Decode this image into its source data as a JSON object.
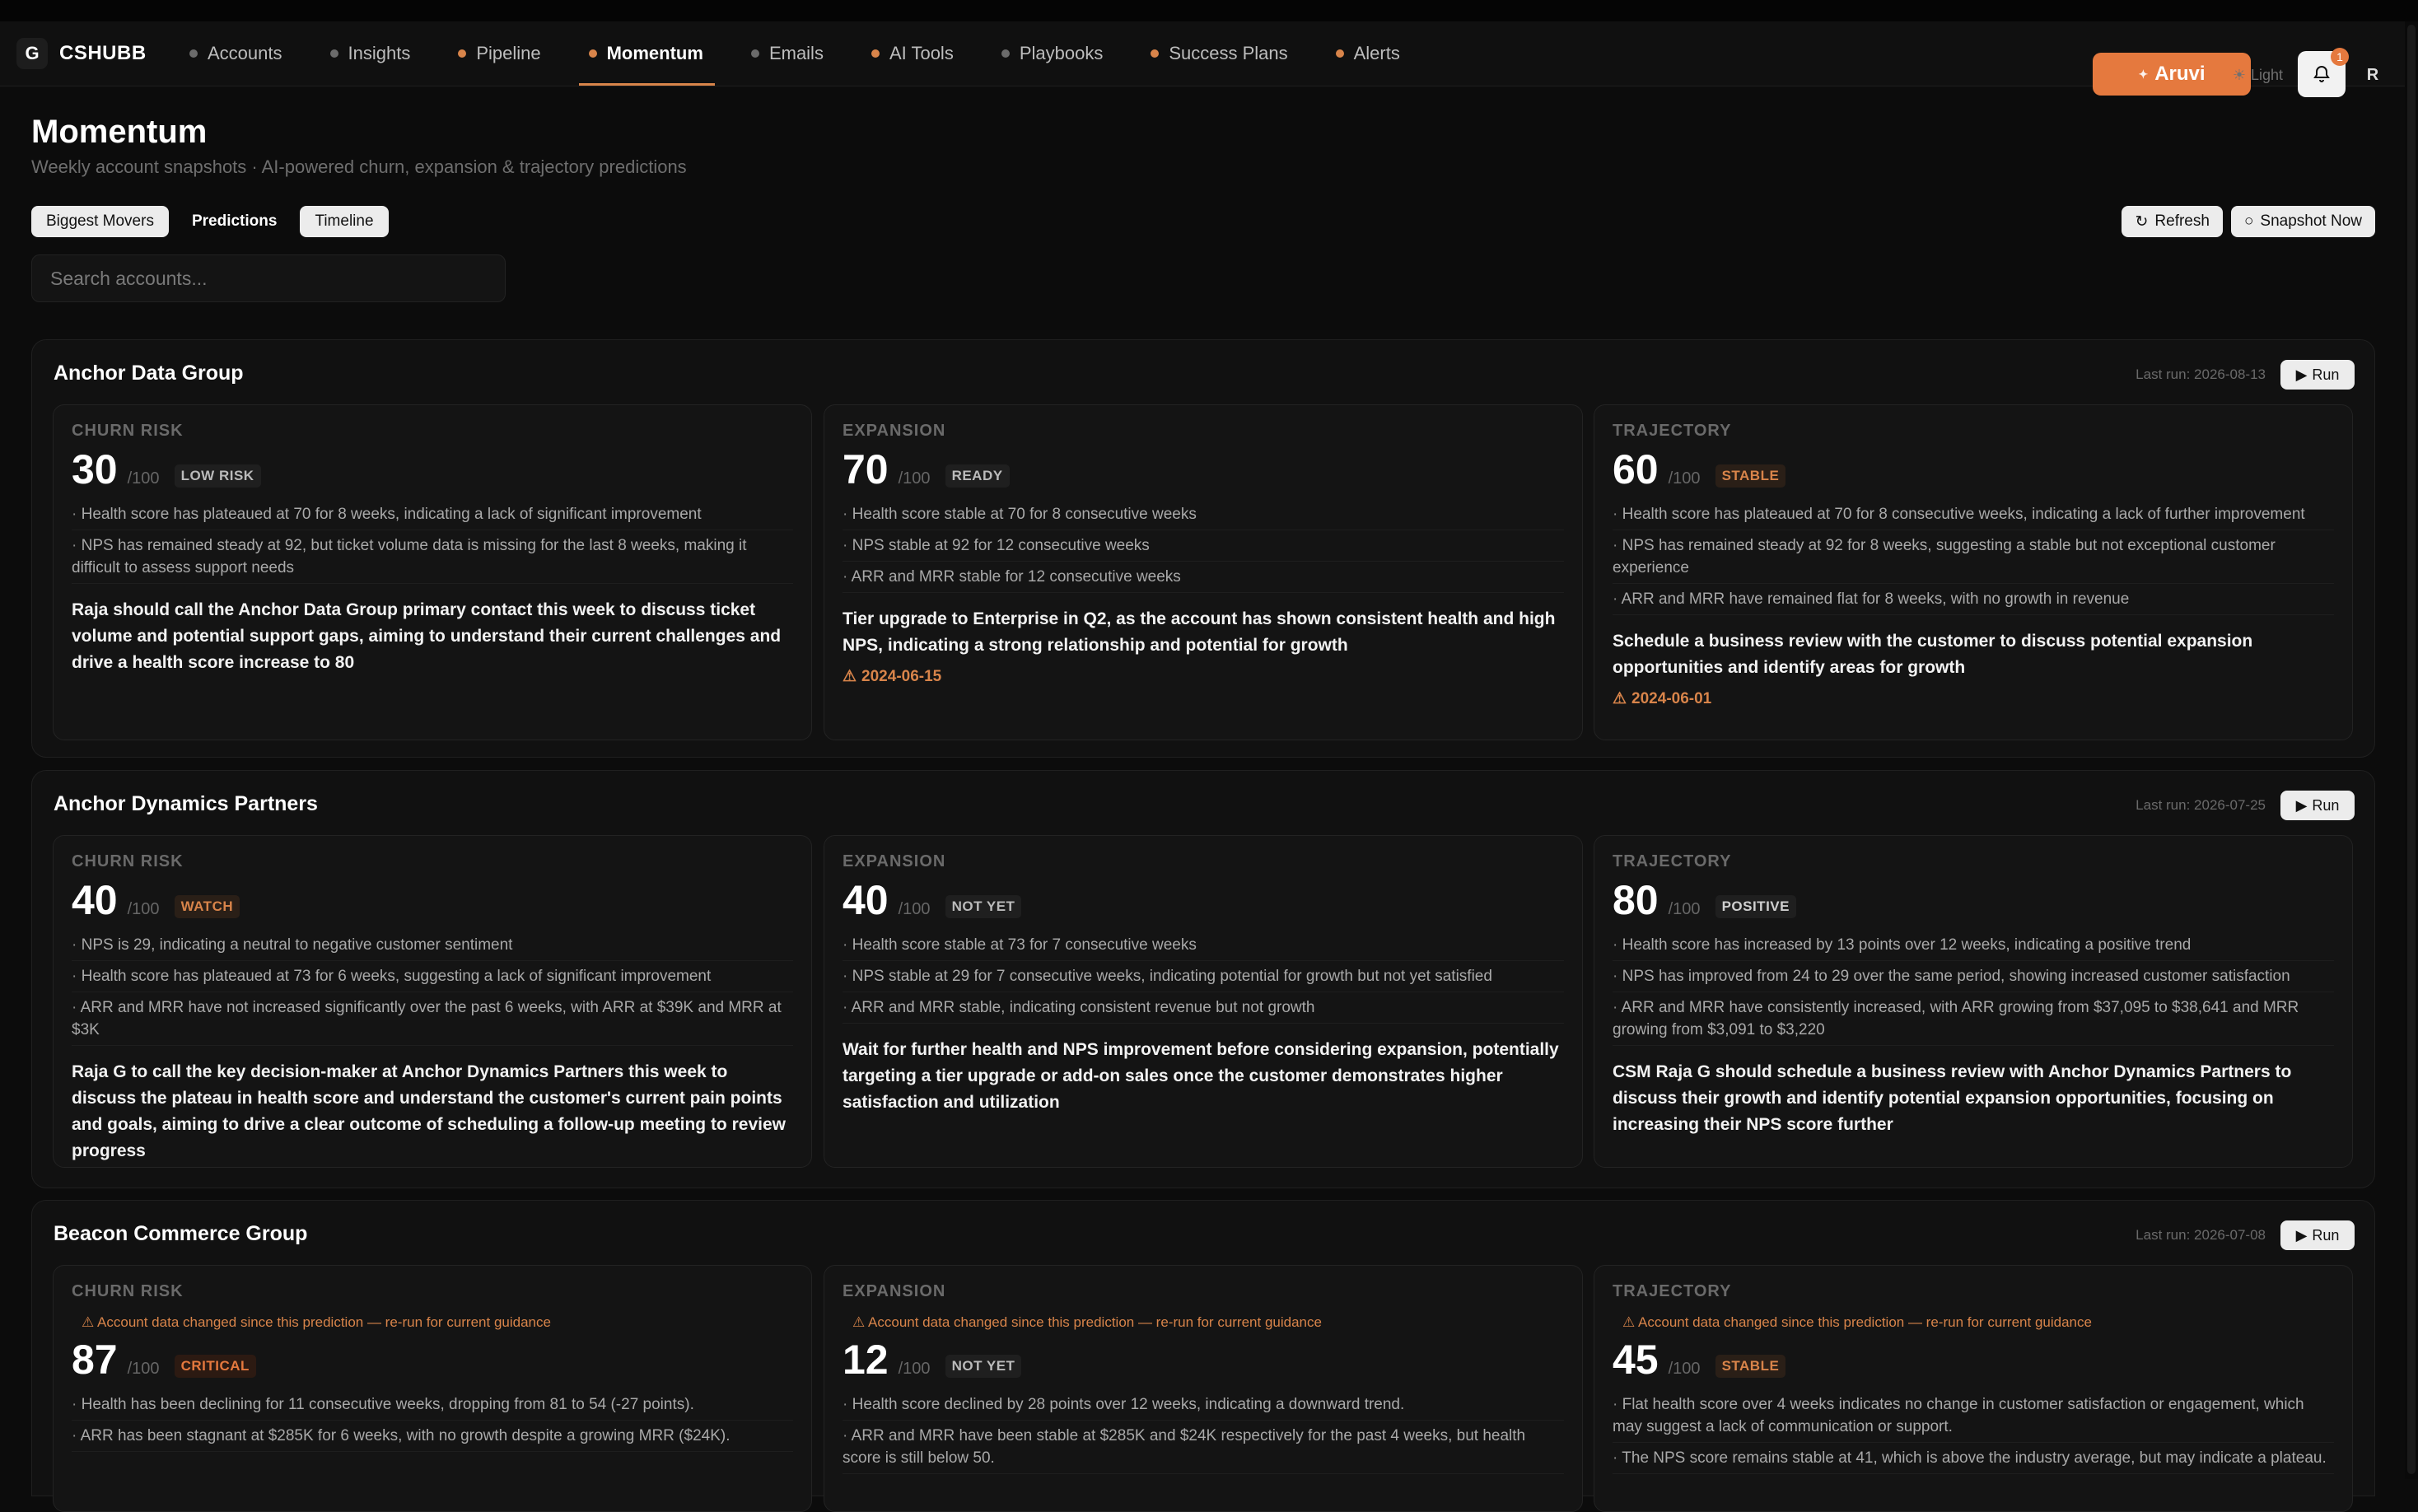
{
  "app": {
    "name": "CSHUBB",
    "logo_glyph": "G"
  },
  "nav": [
    {
      "label": "Accounts",
      "dot": "gray"
    },
    {
      "label": "Insights",
      "dot": "gray"
    },
    {
      "label": "Pipeline",
      "dot": "orange"
    },
    {
      "label": "Momentum",
      "dot": "orange",
      "active": true
    },
    {
      "label": "Emails",
      "dot": "gray"
    },
    {
      "label": "AI Tools",
      "dot": "orange"
    },
    {
      "label": "Playbooks",
      "dot": "gray"
    },
    {
      "label": "Success Plans",
      "dot": "orange"
    },
    {
      "label": "Alerts",
      "dot": "orange"
    }
  ],
  "header": {
    "aruvi_label": "Aruvi",
    "light_label": "Light",
    "notification_count": "1",
    "avatar_initial": "R"
  },
  "page": {
    "title": "Momentum",
    "subtitle": "Weekly account snapshots · AI-powered churn, expansion & trajectory predictions"
  },
  "tabs": [
    "Biggest Movers",
    "Predictions",
    "Timeline"
  ],
  "actions": {
    "refresh": "Refresh",
    "snapshot": "Snapshot Now"
  },
  "search": {
    "placeholder": "Search accounts..."
  },
  "labels": {
    "run": "Run",
    "out_of": "/100"
  },
  "colors": {
    "accent": "#e5793e",
    "background": "#0c0c0c",
    "card": "#141414"
  },
  "accounts": [
    {
      "name": "Anchor Data Group",
      "last_run": "Last run: 2026-08-13",
      "predictions": [
        {
          "label": "CHURN RISK",
          "score": "30",
          "badge": "LOW RISK",
          "badge_tone": "neutral",
          "reasons": [
            "Health score has plateaued at 70 for 8 weeks, indicating a lack of significant improvement",
            "NPS has remained steady at 92, but ticket volume data is missing for the last 8 weeks, making it difficult to assess support needs"
          ],
          "action": "Raja should call the Anchor Data Group primary contact this week to discuss ticket volume and potential support gaps, aiming to understand their current challenges and drive a health score increase to 80"
        },
        {
          "label": "EXPANSION",
          "score": "70",
          "badge": "READY",
          "badge_tone": "neutral",
          "reasons": [
            "Health score stable at 70 for 8 consecutive weeks",
            "NPS stable at 92 for 12 consecutive weeks",
            "ARR and MRR stable for 12 consecutive weeks"
          ],
          "action": "Tier upgrade to Enterprise in Q2, as the account has shown consistent health and high NPS, indicating a strong relationship and potential for growth",
          "due": "2024-06-15"
        },
        {
          "label": "TRAJECTORY",
          "score": "60",
          "badge": "STABLE",
          "badge_tone": "orange",
          "reasons": [
            "Health score has plateaued at 70 for 8 consecutive weeks, indicating a lack of further improvement",
            "NPS has remained steady at 92 for 8 weeks, suggesting a stable but not exceptional customer experience",
            "ARR and MRR have remained flat for 8 weeks, with no growth in revenue"
          ],
          "action": "Schedule a business review with the customer to discuss potential expansion opportunities and identify areas for growth",
          "due": "2024-06-01"
        }
      ]
    },
    {
      "name": "Anchor Dynamics Partners",
      "last_run": "Last run: 2026-07-25",
      "predictions": [
        {
          "label": "CHURN RISK",
          "score": "40",
          "badge": "WATCH",
          "badge_tone": "orange",
          "reasons": [
            "NPS is 29, indicating a neutral to negative customer sentiment",
            "Health score has plateaued at 73 for 6 weeks, suggesting a lack of significant improvement",
            "ARR and MRR have not increased significantly over the past 6 weeks, with ARR at $39K and MRR at $3K"
          ],
          "action": "Raja G to call the key decision-maker at Anchor Dynamics Partners this week to discuss the plateau in health score and understand the customer's current pain points and goals, aiming to drive a clear outcome of scheduling a follow-up meeting to review progress"
        },
        {
          "label": "EXPANSION",
          "score": "40",
          "badge": "NOT YET",
          "badge_tone": "neutral",
          "reasons": [
            "Health score stable at 73 for 7 consecutive weeks",
            "NPS stable at 29 for 7 consecutive weeks, indicating potential for growth but not yet satisfied",
            "ARR and MRR stable, indicating consistent revenue but not growth"
          ],
          "action": "Wait for further health and NPS improvement before considering expansion, potentially targeting a tier upgrade or add-on sales once the customer demonstrates higher satisfaction and utilization"
        },
        {
          "label": "TRAJECTORY",
          "score": "80",
          "badge": "POSITIVE",
          "badge_tone": "green",
          "reasons": [
            "Health score has increased by 13 points over 12 weeks, indicating a positive trend",
            "NPS has improved from 24 to 29 over the same period, showing increased customer satisfaction",
            "ARR and MRR have consistently increased, with ARR growing from $37,095 to $38,641 and MRR growing from $3,091 to $3,220"
          ],
          "action": "CSM Raja G should schedule a business review with Anchor Dynamics Partners to discuss their growth and identify potential expansion opportunities, focusing on increasing their NPS score further"
        }
      ]
    },
    {
      "name": "Beacon Commerce Group",
      "last_run": "Last run: 2026-07-08",
      "predictions": [
        {
          "label": "CHURN RISK",
          "score": "87",
          "badge": "CRITICAL",
          "badge_tone": "red",
          "warning": "Account data changed since this prediction — re-run for current guidance",
          "reasons": [
            "Health has been declining for 11 consecutive weeks, dropping from 81 to 54 (-27 points).",
            "ARR has been stagnant at $285K for 6 weeks, with no growth despite a growing MRR ($24K)."
          ]
        },
        {
          "label": "EXPANSION",
          "score": "12",
          "badge": "NOT YET",
          "badge_tone": "neutral",
          "warning": "Account data changed since this prediction — re-run for current guidance",
          "reasons": [
            "Health score declined by 28 points over 12 weeks, indicating a downward trend.",
            "ARR and MRR have been stable at $285K and $24K respectively for the past 4 weeks, but health score is still below 50."
          ]
        },
        {
          "label": "TRAJECTORY",
          "score": "45",
          "badge": "STABLE",
          "badge_tone": "orange",
          "warning": "Account data changed since this prediction — re-run for current guidance",
          "reasons": [
            "Flat health score over 4 weeks indicates no change in customer satisfaction or engagement, which may suggest a lack of communication or support.",
            "The NPS score remains stable at 41, which is above the industry average, but may indicate a plateau."
          ]
        }
      ]
    }
  ]
}
